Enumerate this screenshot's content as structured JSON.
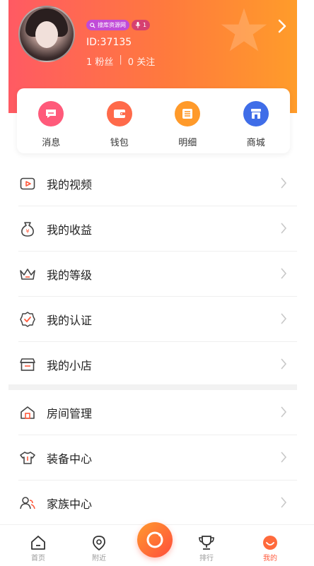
{
  "profile": {
    "badge_text": "搜库资源网",
    "level_badge": "1",
    "uid_text": "ID:37135",
    "fans_text": "1 粉丝",
    "separator": "|",
    "follow_text": "0 关注"
  },
  "quick_actions": [
    {
      "label": "消息",
      "icon": "message-icon",
      "color": "#ff5a7a"
    },
    {
      "label": "钱包",
      "icon": "wallet-icon",
      "color": "#ff6a4a"
    },
    {
      "label": "明细",
      "icon": "list-icon",
      "color": "#ff9a2a"
    },
    {
      "label": "商城",
      "icon": "store-icon",
      "color": "#3f6de8"
    }
  ],
  "menu_group_1": [
    {
      "label": "我的视频",
      "icon": "video-icon"
    },
    {
      "label": "我的收益",
      "icon": "money-bag-icon"
    },
    {
      "label": "我的等级",
      "icon": "crown-icon"
    },
    {
      "label": "我的认证",
      "icon": "certified-icon"
    },
    {
      "label": "我的小店",
      "icon": "shop-icon"
    }
  ],
  "menu_group_2": [
    {
      "label": "房间管理",
      "icon": "house-icon"
    },
    {
      "label": "装备中心",
      "icon": "shirt-icon"
    },
    {
      "label": "家族中心",
      "icon": "family-icon"
    }
  ],
  "bottom_nav": {
    "home": "首页",
    "nearby": "附近",
    "rank": "排行",
    "mine": "我的"
  },
  "colors": {
    "accent": "#ff5a3c",
    "header_start": "#ff5a63",
    "header_end": "#ff9c2a"
  }
}
